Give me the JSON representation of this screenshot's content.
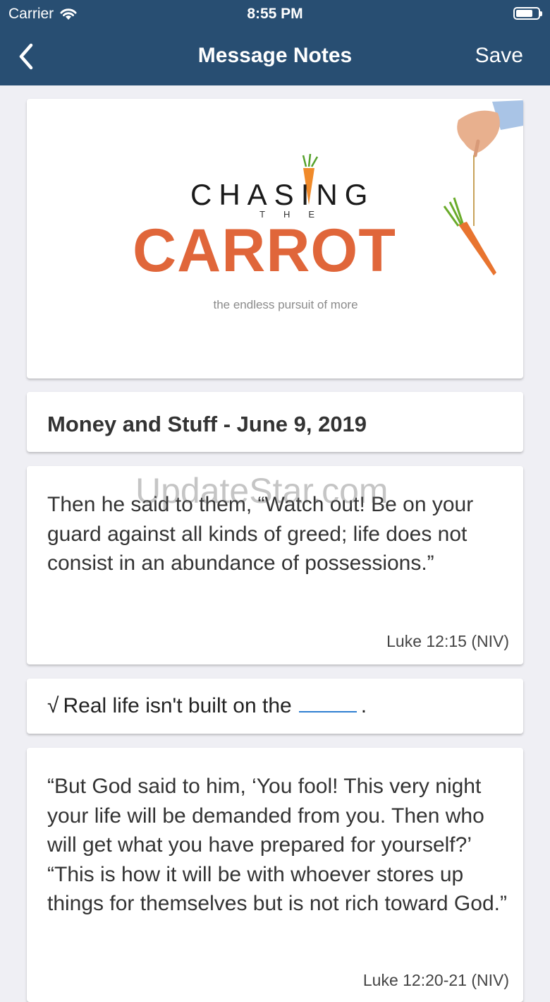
{
  "status_bar": {
    "carrier": "Carrier",
    "time": "8:55 PM",
    "battery_level": 0.75
  },
  "nav": {
    "title": "Message Notes",
    "save_label": "Save"
  },
  "hero": {
    "logo_line1": "CHASING",
    "logo_line2": "THE",
    "logo_line3": "CARROT",
    "tagline": "the endless pursuit of more"
  },
  "sermon": {
    "title": "Money and Stuff - June 9, 2019"
  },
  "quotes": [
    {
      "text": "Then he said to them, “Watch out! Be on your guard against all kinds of greed; life does not consist in an abundance of possessions.”",
      "reference": "Luke 12:15 (NIV)"
    },
    {
      "text": "“But God said to him, ‘You fool! This very night your life will be demanded from you. Then who will get what you have prepared for yourself?’ “This is how it will be with whoever stores up things for themselves but is not rich toward God.”",
      "reference": "Luke 12:20-21 (NIV)"
    }
  ],
  "fill_in": {
    "check": "√",
    "text": "Real life isn't built on the",
    "period": "."
  },
  "watermark": "UpdateStar.com",
  "colors": {
    "header": "#284e72",
    "carrot": "#e0663a",
    "blank_line": "#2f7fd1"
  }
}
